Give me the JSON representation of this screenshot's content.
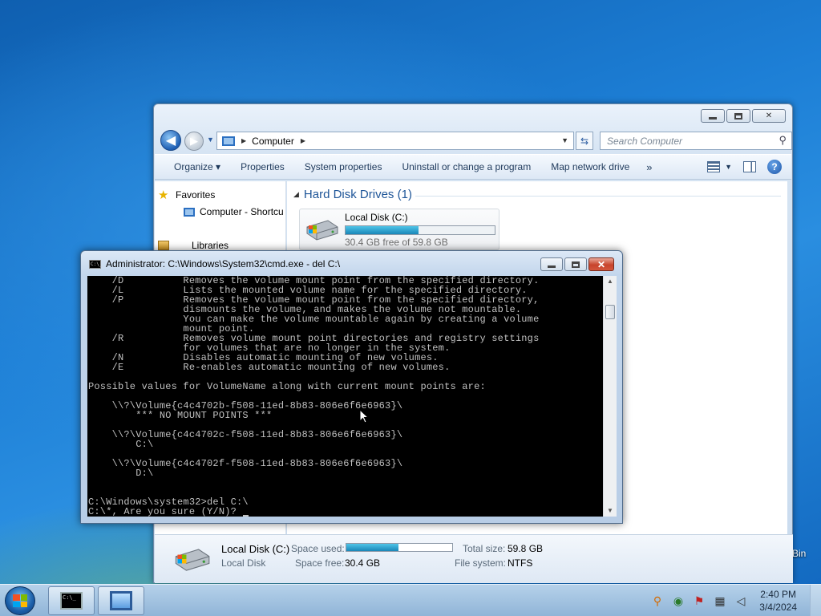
{
  "desktop": {
    "recycle_bin_label": "Bin"
  },
  "explorer": {
    "address": {
      "segment": "Computer"
    },
    "search": {
      "placeholder": "Search Computer"
    },
    "toolbar": {
      "organize": "Organize ▾",
      "properties": "Properties",
      "system_properties": "System properties",
      "uninstall": "Uninstall or change a program",
      "map_drive": "Map network drive",
      "more": "»"
    },
    "nav": {
      "favorites": "Favorites",
      "computer_shortcut": "Computer - Shortcu",
      "libraries": "Libraries"
    },
    "group_header": "Hard Disk Drives (1)",
    "drive": {
      "name": "Local Disk (C:)",
      "free_text": "30.4 GB free of 59.8 GB",
      "used_fraction": 0.49
    },
    "details": {
      "name": "Local Disk (C:)",
      "type": "Local Disk",
      "space_used_label": "Space used:",
      "space_free_label": "Space free:",
      "space_free_value": "30.4 GB",
      "total_size_label": "Total size:",
      "total_size_value": "59.8 GB",
      "file_system_label": "File system:",
      "file_system_value": "NTFS"
    }
  },
  "cmd": {
    "title": "Administrator: C:\\Windows\\System32\\cmd.exe - del  C:\\",
    "lines": [
      "    /D          Removes the volume mount point from the specified directory.",
      "    /L          Lists the mounted volume name for the specified directory.",
      "    /P          Removes the volume mount point from the specified directory,",
      "                dismounts the volume, and makes the volume not mountable.",
      "                You can make the volume mountable again by creating a volume",
      "                mount point.",
      "    /R          Removes volume mount point directories and registry settings",
      "                for volumes that are no longer in the system.",
      "    /N          Disables automatic mounting of new volumes.",
      "    /E          Re-enables automatic mounting of new volumes.",
      "",
      "Possible values for VolumeName along with current mount points are:",
      "",
      "    \\\\?\\Volume{c4c4702b-f508-11ed-8b83-806e6f6e6963}\\",
      "        *** NO MOUNT POINTS ***",
      "",
      "    \\\\?\\Volume{c4c4702c-f508-11ed-8b83-806e6f6e6963}\\",
      "        C:\\",
      "",
      "    \\\\?\\Volume{c4c4702f-f508-11ed-8b83-806e6f6e6963}\\",
      "        D:\\",
      "",
      "",
      "C:\\Windows\\system32>del C:\\",
      "C:\\*, Are you sure (Y/N)? "
    ]
  },
  "taskbar": {
    "time": "2:40 PM",
    "date": "3/4/2024"
  }
}
